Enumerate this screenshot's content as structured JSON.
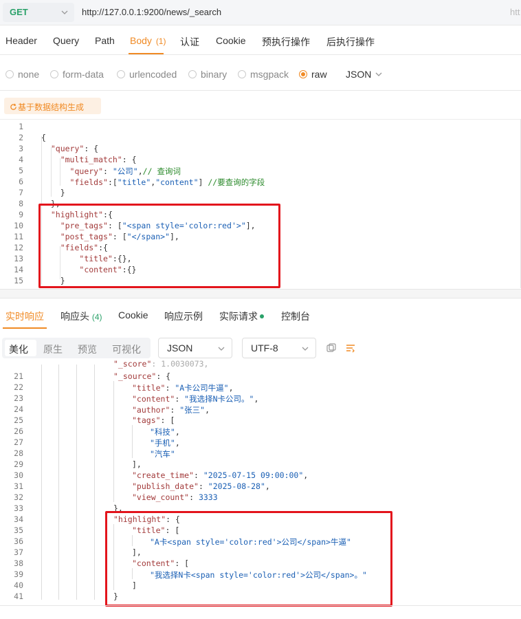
{
  "url_bar": {
    "method": "GET",
    "url": "http://127.0.0.1:9200/news/_search",
    "url_overflow": "htt"
  },
  "request_tabs": [
    {
      "label": "Header"
    },
    {
      "label": "Query"
    },
    {
      "label": "Path"
    },
    {
      "label": "Body",
      "count": "(1)"
    },
    {
      "label": "认证"
    },
    {
      "label": "Cookie"
    },
    {
      "label": "预执行操作"
    },
    {
      "label": "后执行操作"
    }
  ],
  "body_types": [
    "none",
    "form-data",
    "urlencoded",
    "binary",
    "msgpack",
    "raw"
  ],
  "body_format": "JSON",
  "generate_button": "基于数据结构生成",
  "request_code": {
    "line_numbers": [
      "1",
      "2",
      "3",
      "4",
      "5",
      "6",
      "7",
      "8",
      "9",
      "10",
      "11",
      "12",
      "13",
      "14",
      "15"
    ]
  },
  "response_tabs": [
    {
      "label": "实时响应"
    },
    {
      "label": "响应头",
      "count": "(4)"
    },
    {
      "label": "Cookie"
    },
    {
      "label": "响应示例"
    },
    {
      "label": "实际请求"
    },
    {
      "label": "控制台"
    }
  ],
  "view_modes": [
    "美化",
    "原生",
    "预览",
    "可视化"
  ],
  "response_format": "JSON",
  "response_charset": "UTF-8",
  "response_code": {
    "line_numbers": [
      "21",
      "22",
      "23",
      "24",
      "25",
      "26",
      "27",
      "28",
      "29",
      "30",
      "31",
      "32",
      "33",
      "34",
      "35",
      "36",
      "37",
      "38",
      "39",
      "40",
      "41"
    ]
  },
  "colors": {
    "accent": "#f08a24",
    "method_green": "#2aa169",
    "highlight_red": "#e3141c"
  }
}
